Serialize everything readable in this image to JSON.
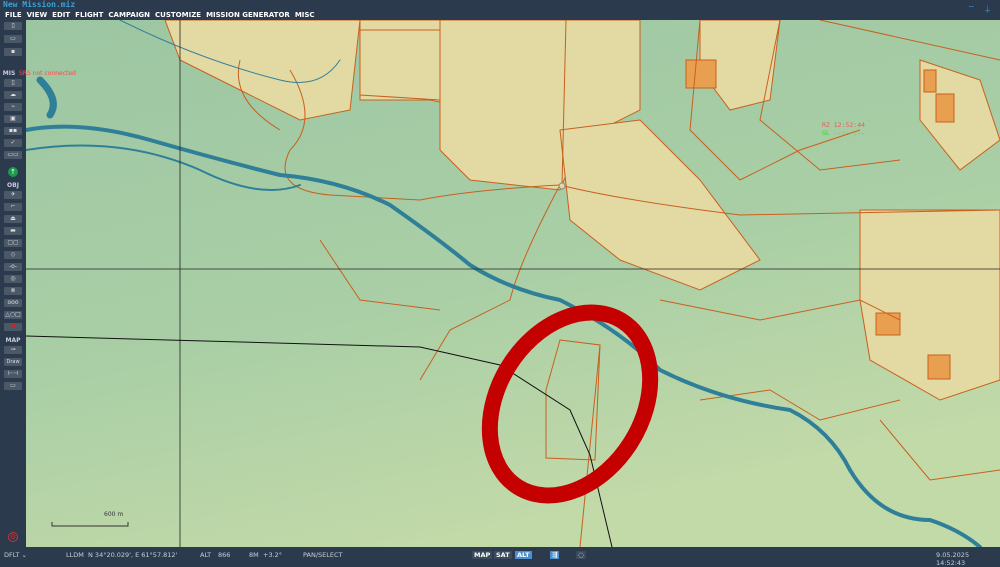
{
  "window": {
    "title": "New Mission.miz"
  },
  "menu": [
    "FILE",
    "VIEW",
    "EDIT",
    "FLIGHT",
    "CAMPAIGN",
    "CUSTOMIZE",
    "MISSION GENERATOR",
    "MISC"
  ],
  "toolbar": {
    "mis_label": "MIS",
    "obj_label": "OBJ",
    "map_label": "MAP",
    "draw_label": "Draw"
  },
  "srs_status": "SRS not connected",
  "hud": {
    "line1": "RZ 12:52:44",
    "line2": "GL --:--:--"
  },
  "scale_bar": "600 m",
  "status": {
    "profile": "DFLT",
    "coord_mode": "LLDM",
    "coords": "N 34°20.029', E 61°57.812'",
    "alt_label": "ALT",
    "alt_value": "866",
    "bm_label": "8M",
    "bm_value": "+3.2°",
    "mode": "PAN/SELECT",
    "map_btn": "MAP",
    "sat_btn": "SAT",
    "alt_btn": "ALT",
    "datetime": "9.05.2025 14:52:43"
  },
  "colors": {
    "terrain": "#a9cfa8",
    "town": "#e3d9a3",
    "road": "#c8601e",
    "river": "#2f7f98",
    "highlight": "#c40000"
  }
}
